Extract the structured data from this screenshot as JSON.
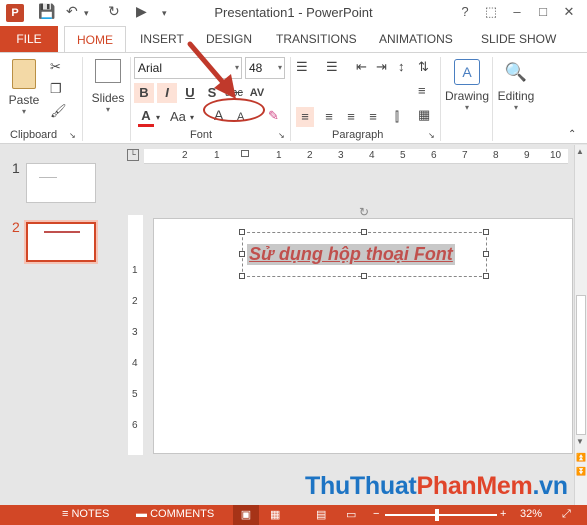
{
  "window": {
    "title": "Presentation1 - PowerPoint",
    "app_logo": "P",
    "qat_icons": [
      "save-icon",
      "undo-icon",
      "redo-icon",
      "slideshow-from-start-icon",
      "customize-qat-icon"
    ],
    "controls": [
      "?",
      "restore-icon",
      "minimize-icon",
      "maximize-icon",
      "close-icon"
    ]
  },
  "tabs": {
    "file": "FILE",
    "items": [
      "HOME",
      "INSERT",
      "DESIGN",
      "TRANSITIONS",
      "ANIMATIONS",
      "SLIDE SHOW"
    ],
    "active": "HOME"
  },
  "ribbon": {
    "clipboard": {
      "label": "Clipboard",
      "paste": "Paste"
    },
    "slides": {
      "new_slide": "Slides"
    },
    "font": {
      "label": "Font",
      "font_name": "Arial",
      "font_size": "48",
      "bold": "B",
      "italic": "I",
      "underline": "U",
      "shadow": "S",
      "strike": "abc",
      "font_color_glyph": "A",
      "change_case": "Aa",
      "grow_font": "A",
      "shrink_font": "A",
      "spacing": "AV"
    },
    "paragraph": {
      "label": "Paragraph"
    },
    "drawing": {
      "label": "Drawing"
    },
    "editing": {
      "label": "Editing"
    }
  },
  "thumbnails": {
    "items": [
      {
        "number": "1"
      },
      {
        "number": "2"
      }
    ],
    "selected": "2"
  },
  "ruler": {
    "horizontal": [
      "2",
      "1",
      "0",
      "1",
      "2",
      "3",
      "4",
      "5",
      "6",
      "7",
      "8",
      "9",
      "10"
    ],
    "vertical": [
      "1",
      "2",
      "3",
      "4",
      "5",
      "6"
    ]
  },
  "slide": {
    "title_text": "Sử dụng hộp thoại Font"
  },
  "statusbar": {
    "notes": "NOTES",
    "comments": "COMMENTS",
    "zoom": "32%"
  },
  "watermark": {
    "part1": "ThuThuat",
    "part2": "PhanMem",
    "part3": ".vn",
    "color1": "#1d74c4",
    "color2": "#e0452a"
  },
  "accent": "#d24726"
}
